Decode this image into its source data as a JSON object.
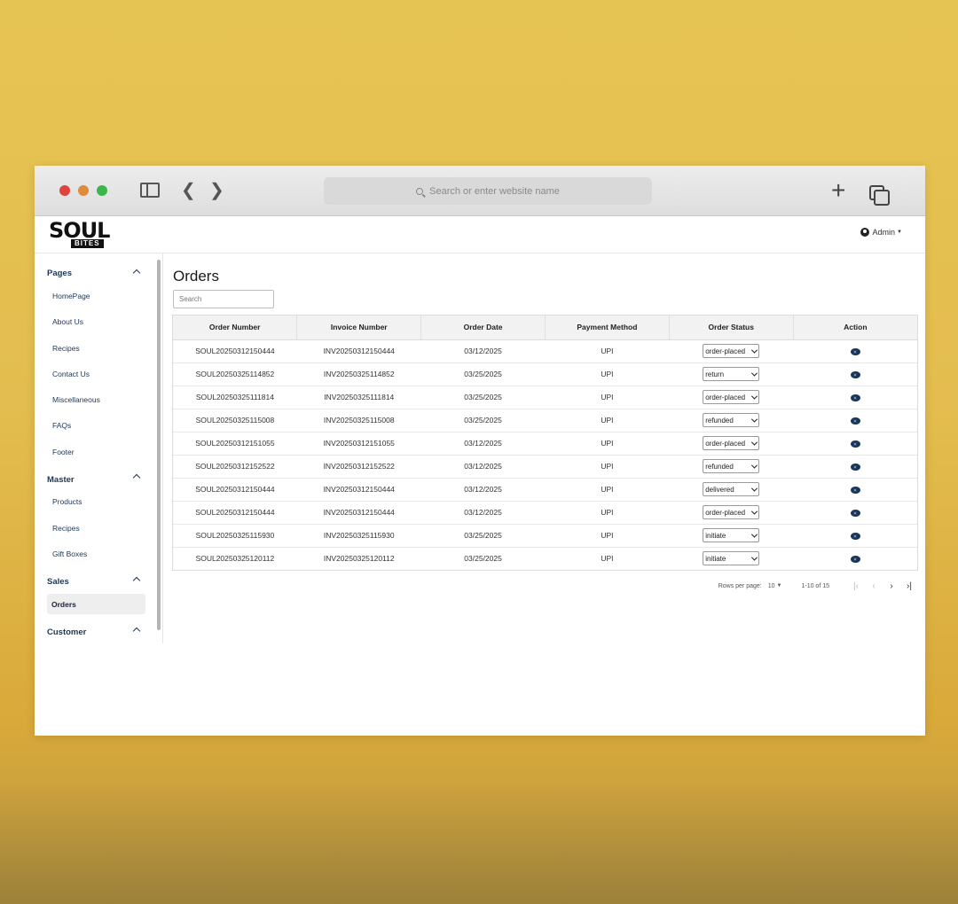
{
  "browser": {
    "address_placeholder": "Search or enter website name"
  },
  "header": {
    "logo_main": "SOUL",
    "logo_sub": "BITES",
    "user_label": "Admin"
  },
  "sidebar": {
    "sections": [
      {
        "title": "Pages",
        "items": [
          "HomePage",
          "About Us",
          "Recipes",
          "Contact Us",
          "Miscellaneous",
          "FAQs",
          "Footer"
        ]
      },
      {
        "title": "Master",
        "items": [
          "Products",
          "Recipes",
          "Gift Boxes"
        ]
      },
      {
        "title": "Sales",
        "items": [
          "Orders"
        ]
      },
      {
        "title": "Customer",
        "items": []
      }
    ],
    "active_item": "Orders"
  },
  "main": {
    "title": "Orders",
    "search_placeholder": "Search",
    "columns": [
      "Order Number",
      "Invoice Number",
      "Order Date",
      "Payment Method",
      "Order Status",
      "Action"
    ],
    "rows": [
      {
        "order": "SOUL20250312150444",
        "invoice": "INV20250312150444",
        "date": "03/12/2025",
        "payment": "UPI",
        "status": "order-placed"
      },
      {
        "order": "SOUL20250325114852",
        "invoice": "INV20250325114852",
        "date": "03/25/2025",
        "payment": "UPI",
        "status": "return"
      },
      {
        "order": "SOUL20250325111814",
        "invoice": "INV20250325111814",
        "date": "03/25/2025",
        "payment": "UPI",
        "status": "order-placed"
      },
      {
        "order": "SOUL20250325115008",
        "invoice": "INV20250325115008",
        "date": "03/25/2025",
        "payment": "UPI",
        "status": "refunded"
      },
      {
        "order": "SOUL20250312151055",
        "invoice": "INV20250312151055",
        "date": "03/12/2025",
        "payment": "UPI",
        "status": "order-placed"
      },
      {
        "order": "SOUL20250312152522",
        "invoice": "INV20250312152522",
        "date": "03/12/2025",
        "payment": "UPI",
        "status": "refunded"
      },
      {
        "order": "SOUL20250312150444",
        "invoice": "INV20250312150444",
        "date": "03/12/2025",
        "payment": "UPI",
        "status": "delivered"
      },
      {
        "order": "SOUL20250312150444",
        "invoice": "INV20250312150444",
        "date": "03/12/2025",
        "payment": "UPI",
        "status": "order-placed"
      },
      {
        "order": "SOUL20250325115930",
        "invoice": "INV20250325115930",
        "date": "03/25/2025",
        "payment": "UPI",
        "status": "initiate"
      },
      {
        "order": "SOUL20250325120112",
        "invoice": "INV20250325120112",
        "date": "03/25/2025",
        "payment": "UPI",
        "status": "initiate"
      }
    ],
    "pagination": {
      "rows_per_page_label": "Rows per page:",
      "rows_per_page": "10",
      "range": "1-10 of 15"
    }
  },
  "colors": {
    "background": "#e3bd4f",
    "nav_text": "#1c3656",
    "action_icon": "#17345a"
  }
}
